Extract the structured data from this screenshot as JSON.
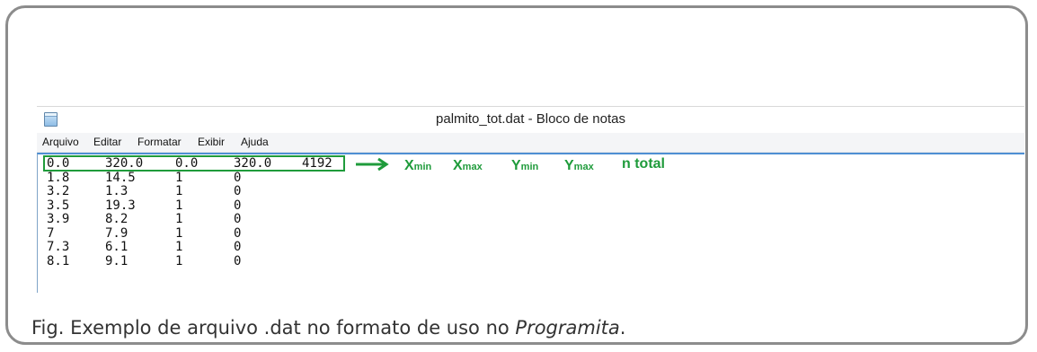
{
  "window": {
    "title": "palmito_tot.dat - Bloco de notas",
    "icon": "notepad-icon"
  },
  "menu": [
    "Arquivo",
    "Editar",
    "Formatar",
    "Exibir",
    "Ajuda"
  ],
  "file_rows": [
    [
      "0.0",
      "320.0",
      "0.0",
      "320.0",
      "4192"
    ],
    [
      "1.8",
      "14.5",
      "1",
      "0",
      ""
    ],
    [
      "3.2",
      "1.3",
      "1",
      "0",
      ""
    ],
    [
      "3.5",
      "19.3",
      "1",
      "0",
      ""
    ],
    [
      "3.9",
      "8.2",
      "1",
      "0",
      ""
    ],
    [
      "7",
      "7.9",
      "1",
      "0",
      ""
    ],
    [
      "7.3",
      "6.1",
      "1",
      "0",
      ""
    ],
    [
      "8.1",
      "9.1",
      "1",
      "0",
      ""
    ]
  ],
  "annotation": {
    "color": "#1f9b3b",
    "labels": [
      {
        "main": "X",
        "sub": "min"
      },
      {
        "main": "X",
        "sub": "max"
      },
      {
        "main": "Y",
        "sub": "min"
      },
      {
        "main": "Y",
        "sub": "max"
      },
      {
        "main": "n total",
        "sub": ""
      }
    ]
  },
  "caption": {
    "prefix": "Fig. Exemplo de arquivo .dat no formato de uso no ",
    "emphasis": "Programita",
    "suffix": "."
  }
}
